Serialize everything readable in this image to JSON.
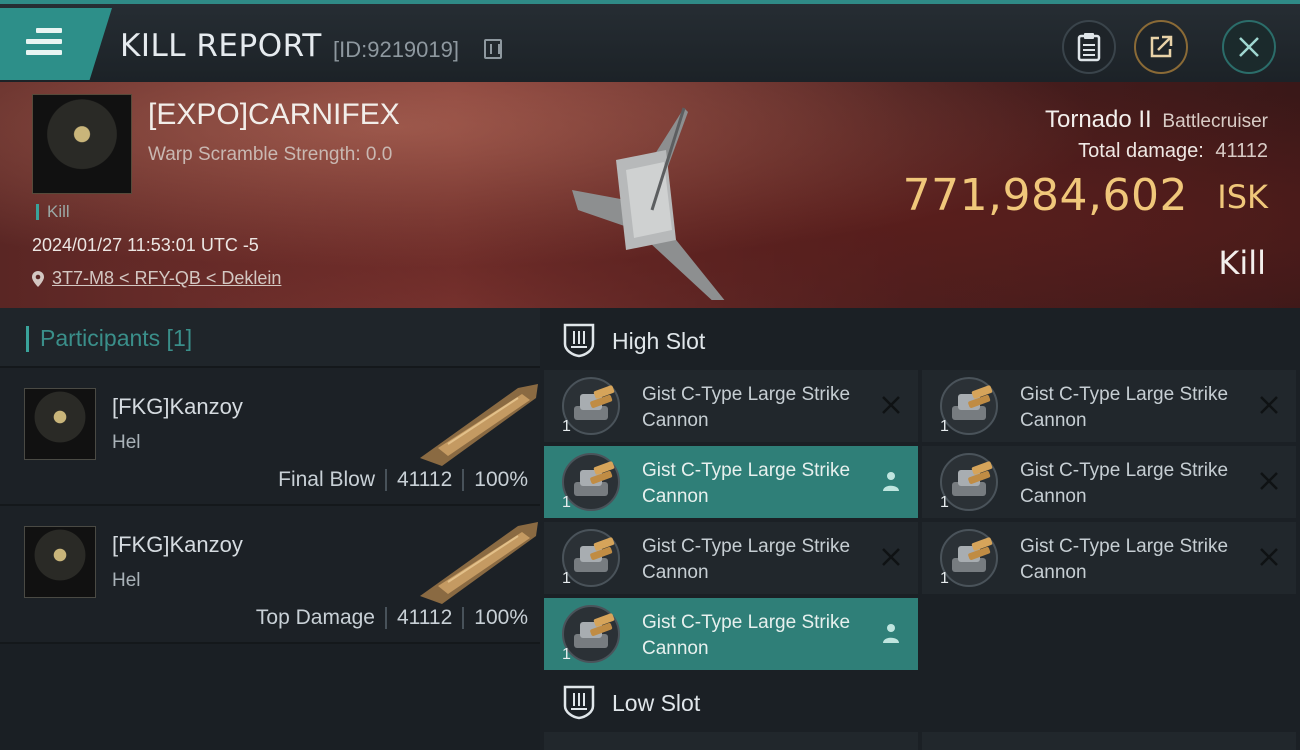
{
  "header": {
    "title": "KILL REPORT",
    "report_id": "[ID:9219019]"
  },
  "victim": {
    "name": "[EXPO]CARNIFEX",
    "scramble": "Warp Scramble Strength: 0.0",
    "kill_tag": "Kill",
    "timestamp": "2024/01/27 11:53:01 UTC -5",
    "location": "3T7-M8 < RFY-QB < Deklein",
    "ship_name": "Tornado II",
    "ship_class": "Battlecruiser",
    "total_damage_label": "Total damage:",
    "total_damage": "41112",
    "isk_value": "771,984,602",
    "isk_unit": "ISK",
    "result": "Kill"
  },
  "participants": {
    "header": "Participants [1]",
    "rows": [
      {
        "name": "[FKG]Kanzoy",
        "ship": "Hel",
        "role": "Final Blow",
        "damage": "41112",
        "percent": "100%"
      },
      {
        "name": "[FKG]Kanzoy",
        "ship": "Hel",
        "role": "Top Damage",
        "damage": "41112",
        "percent": "100%"
      }
    ]
  },
  "slots": {
    "high_label": "High Slot",
    "low_label": "Low Slot",
    "high_modules": [
      {
        "qty": "1",
        "name": "Gist C-Type Large Strike Cannon",
        "state": "destroyed"
      },
      {
        "qty": "1",
        "name": "Gist C-Type Large Strike Cannon",
        "state": "destroyed"
      },
      {
        "qty": "1",
        "name": "Gist C-Type Large Strike Cannon",
        "state": "dropped"
      },
      {
        "qty": "1",
        "name": "Gist C-Type Large Strike Cannon",
        "state": "destroyed"
      },
      {
        "qty": "1",
        "name": "Gist C-Type Large Strike Cannon",
        "state": "destroyed"
      },
      {
        "qty": "1",
        "name": "Gist C-Type Large Strike Cannon",
        "state": "destroyed"
      },
      {
        "qty": "1",
        "name": "Gist C-Type Large Strike Cannon",
        "state": "dropped"
      }
    ]
  },
  "colors": {
    "accent": "#2d8f89",
    "isk": "#f0c77a",
    "dropped_bg": "#2f7f78"
  },
  "icons": [
    "menu-icon",
    "copy-icon",
    "clipboard-icon",
    "share-icon",
    "close-icon",
    "pin-icon",
    "shield-icon",
    "destroyed-x-icon",
    "dropped-person-icon"
  ]
}
